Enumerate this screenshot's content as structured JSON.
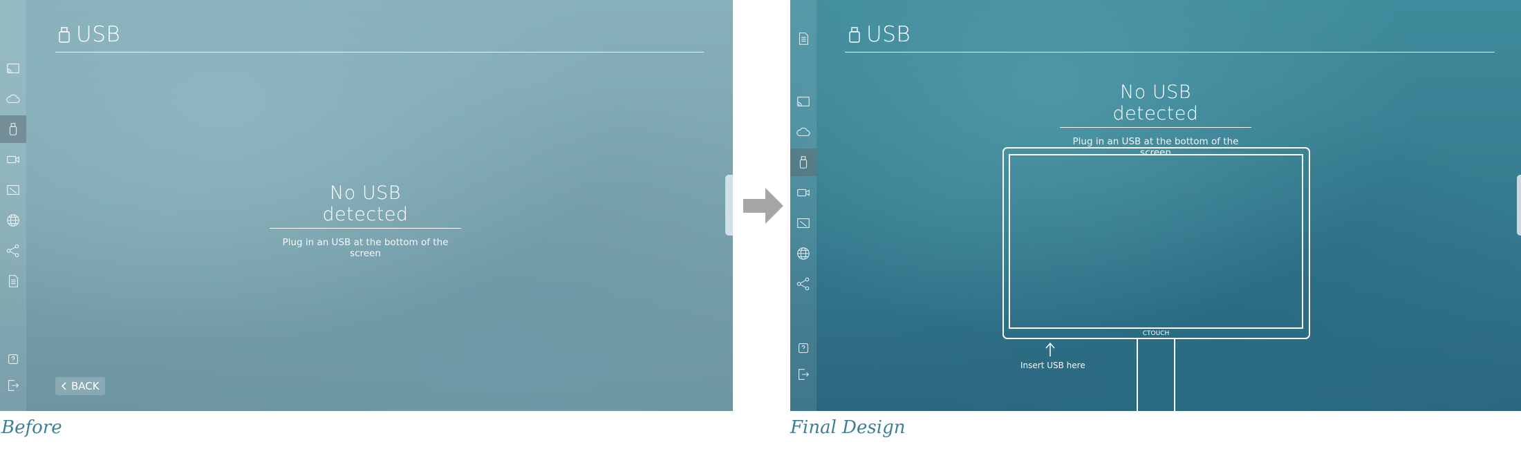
{
  "before": {
    "title": "USB",
    "message_title": "No USB detected",
    "message_subtitle": "Plug in an USB at the bottom of the screen",
    "back_label": "BACK",
    "sidebar_icons": [
      "cast-icon",
      "cloud-icon",
      "usb-icon",
      "camera-icon",
      "whiteboard-icon",
      "globe-icon",
      "share-icon",
      "document-icon",
      "help-icon",
      "exit-icon"
    ],
    "active_icon": "usb-icon"
  },
  "after": {
    "title": "USB",
    "message_title": "No USB detected",
    "message_subtitle": "Plug in an USB at the bottom of the screen",
    "monitor_brand": "CTOUCH",
    "insert_hint": "Insert USB here",
    "sidebar_icons": [
      "document-icon",
      "cast-icon",
      "cloud-icon",
      "usb-icon",
      "camera-icon",
      "whiteboard-icon",
      "globe-icon",
      "share-icon",
      "help-icon",
      "exit-icon"
    ],
    "active_icon": "usb-icon"
  },
  "captions": {
    "before": "Before",
    "after": "Final Design"
  },
  "colors": {
    "before_background": "#80a9b4",
    "after_background": "#3a8194",
    "caption_text": "#3f7f94",
    "arrow": "#a6a6a6"
  }
}
